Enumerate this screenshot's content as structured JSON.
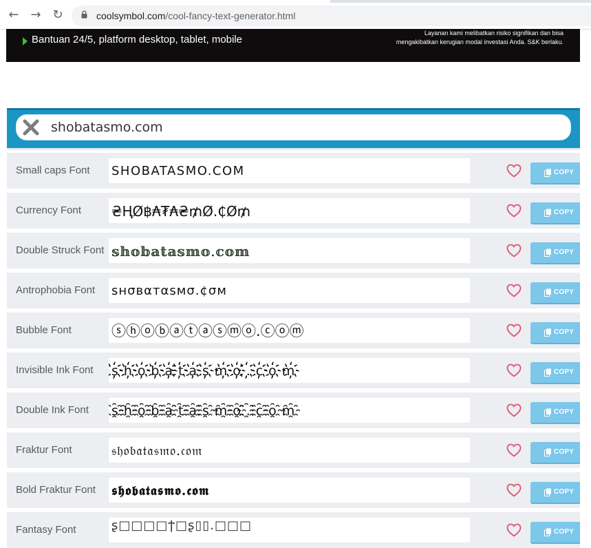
{
  "browser": {
    "url_domain": "coolsymbol.com",
    "url_path": "/cool-fancy-text-generator.html",
    "back_glyph": "←",
    "forward_glyph": "→",
    "reload_glyph": "↻"
  },
  "ad": {
    "headline": "Bantuan 24/5, platform desktop, tablet, mobile",
    "disclaimer_line1": "Layanan kami melibatkan risiko signifikan dan bisa",
    "disclaimer_line2": "mengakibatkan kerugian modal investasi Anda. S&K berlaku."
  },
  "search": {
    "value": "shobatasmo.com",
    "clear_icon": "x-mark-icon"
  },
  "rows": [
    {
      "label": "Small caps Font",
      "output": "SHOBATASMO.COM"
    },
    {
      "label": "Currency Font",
      "output": "₴ⱧØ฿₳₮₳₴₥Ø.₵Ø₥"
    },
    {
      "label": "Double Struck Font",
      "output": "𝕤𝕙𝕠𝕓𝕒𝕥𝕒𝕤𝕞𝕠.𝕔𝕠𝕞"
    },
    {
      "label": "Antrophobia Font",
      "output": "ѕнσвαтαѕмσ.¢σм"
    },
    {
      "label": "Bubble Font",
      "output": "ⓢⓗⓞⓑⓐⓣⓐⓢⓜⓞ.ⓒⓞⓜ"
    },
    {
      "label": "Invisible Ink Font",
      "output": "s҉h҉o҉b҉a҉t҉a҉s҉m҉o҉.҉c҉o҉m҉"
    },
    {
      "label": "Double Ink Font",
      "output": "s҈h҈o҈b҈a҈t҈a҈s҈m҈o҈.҈c҈o҈m҈"
    },
    {
      "label": "Fraktur Font",
      "output": "𝔰𝔥𝔬𝔟𝔞𝔱𝔞𝔰𝔪𝔬.𝔠𝔬𝔪"
    },
    {
      "label": "Bold Fraktur Font",
      "output": "𝖘𝖍𝖔𝖇𝖆𝖙𝖆𝖘𝖒𝖔.𝖈𝖔𝖒"
    },
    {
      "label": "Fantasy Font",
      "output": "ʂ□□□□ϯ□ʂ▯▯.□□□"
    }
  ],
  "copy_label": "COPY",
  "colors": {
    "accent": "#1a95c4",
    "copy_button": "#7cc7ea",
    "heart": "#e0506e",
    "row_bg": "#eceef1"
  }
}
